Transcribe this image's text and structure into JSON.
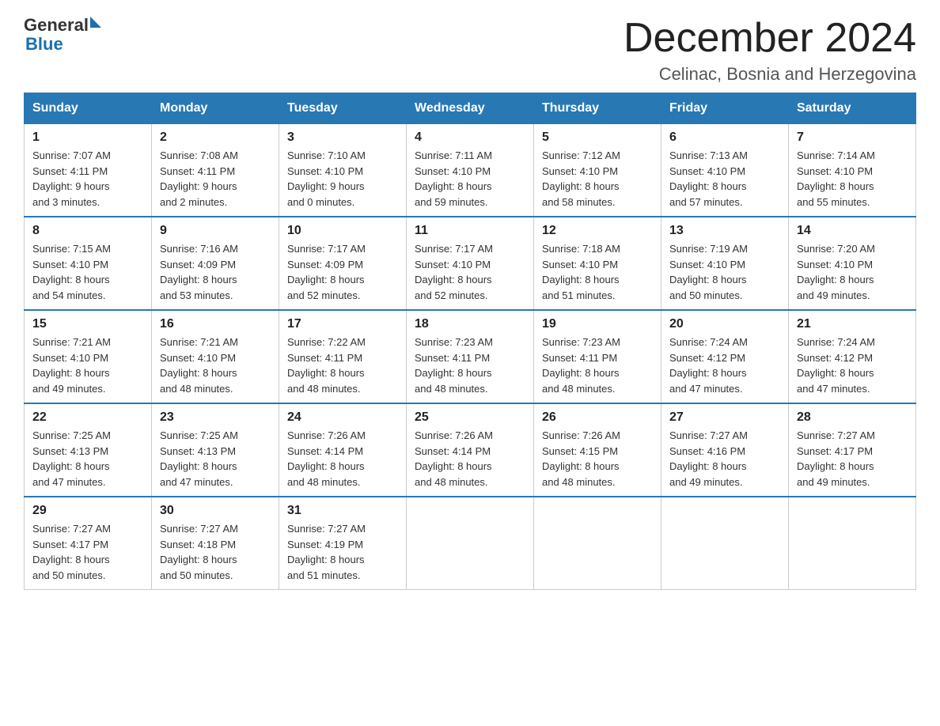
{
  "header": {
    "logo_text": "General",
    "logo_blue": "Blue",
    "month_title": "December 2024",
    "location": "Celinac, Bosnia and Herzegovina"
  },
  "weekdays": [
    "Sunday",
    "Monday",
    "Tuesday",
    "Wednesday",
    "Thursday",
    "Friday",
    "Saturday"
  ],
  "weeks": [
    [
      {
        "day": "1",
        "info": "Sunrise: 7:07 AM\nSunset: 4:11 PM\nDaylight: 9 hours\nand 3 minutes."
      },
      {
        "day": "2",
        "info": "Sunrise: 7:08 AM\nSunset: 4:11 PM\nDaylight: 9 hours\nand 2 minutes."
      },
      {
        "day": "3",
        "info": "Sunrise: 7:10 AM\nSunset: 4:10 PM\nDaylight: 9 hours\nand 0 minutes."
      },
      {
        "day": "4",
        "info": "Sunrise: 7:11 AM\nSunset: 4:10 PM\nDaylight: 8 hours\nand 59 minutes."
      },
      {
        "day": "5",
        "info": "Sunrise: 7:12 AM\nSunset: 4:10 PM\nDaylight: 8 hours\nand 58 minutes."
      },
      {
        "day": "6",
        "info": "Sunrise: 7:13 AM\nSunset: 4:10 PM\nDaylight: 8 hours\nand 57 minutes."
      },
      {
        "day": "7",
        "info": "Sunrise: 7:14 AM\nSunset: 4:10 PM\nDaylight: 8 hours\nand 55 minutes."
      }
    ],
    [
      {
        "day": "8",
        "info": "Sunrise: 7:15 AM\nSunset: 4:10 PM\nDaylight: 8 hours\nand 54 minutes."
      },
      {
        "day": "9",
        "info": "Sunrise: 7:16 AM\nSunset: 4:09 PM\nDaylight: 8 hours\nand 53 minutes."
      },
      {
        "day": "10",
        "info": "Sunrise: 7:17 AM\nSunset: 4:09 PM\nDaylight: 8 hours\nand 52 minutes."
      },
      {
        "day": "11",
        "info": "Sunrise: 7:17 AM\nSunset: 4:10 PM\nDaylight: 8 hours\nand 52 minutes."
      },
      {
        "day": "12",
        "info": "Sunrise: 7:18 AM\nSunset: 4:10 PM\nDaylight: 8 hours\nand 51 minutes."
      },
      {
        "day": "13",
        "info": "Sunrise: 7:19 AM\nSunset: 4:10 PM\nDaylight: 8 hours\nand 50 minutes."
      },
      {
        "day": "14",
        "info": "Sunrise: 7:20 AM\nSunset: 4:10 PM\nDaylight: 8 hours\nand 49 minutes."
      }
    ],
    [
      {
        "day": "15",
        "info": "Sunrise: 7:21 AM\nSunset: 4:10 PM\nDaylight: 8 hours\nand 49 minutes."
      },
      {
        "day": "16",
        "info": "Sunrise: 7:21 AM\nSunset: 4:10 PM\nDaylight: 8 hours\nand 48 minutes."
      },
      {
        "day": "17",
        "info": "Sunrise: 7:22 AM\nSunset: 4:11 PM\nDaylight: 8 hours\nand 48 minutes."
      },
      {
        "day": "18",
        "info": "Sunrise: 7:23 AM\nSunset: 4:11 PM\nDaylight: 8 hours\nand 48 minutes."
      },
      {
        "day": "19",
        "info": "Sunrise: 7:23 AM\nSunset: 4:11 PM\nDaylight: 8 hours\nand 48 minutes."
      },
      {
        "day": "20",
        "info": "Sunrise: 7:24 AM\nSunset: 4:12 PM\nDaylight: 8 hours\nand 47 minutes."
      },
      {
        "day": "21",
        "info": "Sunrise: 7:24 AM\nSunset: 4:12 PM\nDaylight: 8 hours\nand 47 minutes."
      }
    ],
    [
      {
        "day": "22",
        "info": "Sunrise: 7:25 AM\nSunset: 4:13 PM\nDaylight: 8 hours\nand 47 minutes."
      },
      {
        "day": "23",
        "info": "Sunrise: 7:25 AM\nSunset: 4:13 PM\nDaylight: 8 hours\nand 47 minutes."
      },
      {
        "day": "24",
        "info": "Sunrise: 7:26 AM\nSunset: 4:14 PM\nDaylight: 8 hours\nand 48 minutes."
      },
      {
        "day": "25",
        "info": "Sunrise: 7:26 AM\nSunset: 4:14 PM\nDaylight: 8 hours\nand 48 minutes."
      },
      {
        "day": "26",
        "info": "Sunrise: 7:26 AM\nSunset: 4:15 PM\nDaylight: 8 hours\nand 48 minutes."
      },
      {
        "day": "27",
        "info": "Sunrise: 7:27 AM\nSunset: 4:16 PM\nDaylight: 8 hours\nand 49 minutes."
      },
      {
        "day": "28",
        "info": "Sunrise: 7:27 AM\nSunset: 4:17 PM\nDaylight: 8 hours\nand 49 minutes."
      }
    ],
    [
      {
        "day": "29",
        "info": "Sunrise: 7:27 AM\nSunset: 4:17 PM\nDaylight: 8 hours\nand 50 minutes."
      },
      {
        "day": "30",
        "info": "Sunrise: 7:27 AM\nSunset: 4:18 PM\nDaylight: 8 hours\nand 50 minutes."
      },
      {
        "day": "31",
        "info": "Sunrise: 7:27 AM\nSunset: 4:19 PM\nDaylight: 8 hours\nand 51 minutes."
      },
      null,
      null,
      null,
      null
    ]
  ]
}
